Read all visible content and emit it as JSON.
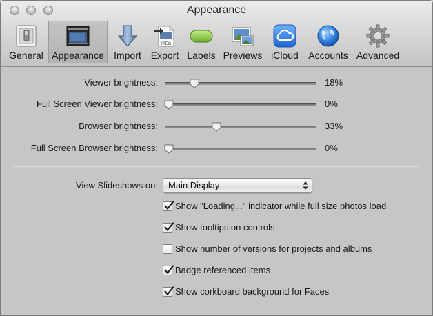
{
  "window": {
    "title": "Appearance"
  },
  "toolbar": {
    "items": [
      {
        "label": "General",
        "icon": "switch-icon",
        "selected": false
      },
      {
        "label": "Appearance",
        "icon": "display-icon",
        "selected": true
      },
      {
        "label": "Import",
        "icon": "import-arrow-icon",
        "selected": false
      },
      {
        "label": "Export",
        "icon": "jpeg-export-icon",
        "selected": false
      },
      {
        "label": "Labels",
        "icon": "green-label-icon",
        "selected": false
      },
      {
        "label": "Previews",
        "icon": "previews-icon",
        "selected": false
      },
      {
        "label": "iCloud",
        "icon": "icloud-icon",
        "selected": false
      },
      {
        "label": "Accounts",
        "icon": "globe-icon",
        "selected": false
      },
      {
        "label": "Advanced",
        "icon": "gear-icon",
        "selected": false
      }
    ]
  },
  "brightness": {
    "sliders": [
      {
        "label": "Viewer brightness:",
        "value": "18%",
        "fraction": 0.18
      },
      {
        "label": "Full Screen Viewer brightness:",
        "value": "0%",
        "fraction": 0.0
      },
      {
        "label": "Browser brightness:",
        "value": "33%",
        "fraction": 0.33
      },
      {
        "label": "Full Screen Browser brightness:",
        "value": "0%",
        "fraction": 0.0
      }
    ]
  },
  "slideshows": {
    "label": "View Slideshows on:",
    "selected": "Main Display"
  },
  "options": [
    {
      "label": "Show \"Loading...\" indicator while full size photos load",
      "checked": true
    },
    {
      "label": "Show tooltips on controls",
      "checked": true
    },
    {
      "label": "Show number of versions for projects and albums",
      "checked": false
    },
    {
      "label": "Badge referenced items",
      "checked": true
    },
    {
      "label": "Show corkboard background for Faces",
      "checked": true
    }
  ]
}
